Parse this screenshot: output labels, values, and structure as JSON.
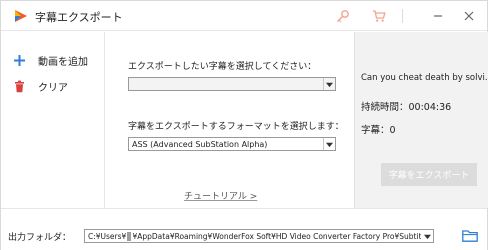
{
  "window": {
    "title": "字幕エクスポート"
  },
  "sidebar": {
    "add_label": "動画を追加",
    "clear_label": "クリア"
  },
  "main": {
    "select_subtitle_label": "エクスポートしたい字幕を選択してください：",
    "subtitle_select_value": "",
    "format_label": "字幕をエクスポートするフォーマットを選択します：",
    "format_select_value": "ASS (Advanced SubStation Alpha)",
    "tutorial_link": "チュートリアル >"
  },
  "info": {
    "file_name": "Can you cheat death by solvi...",
    "duration": "持続時間：00:04:36",
    "subtitle_count": "字幕：0",
    "export_button": "字幕をエクスポート"
  },
  "output": {
    "label": "出力フォルダ：",
    "path_prefix": "C:¥Users¥",
    "path_suffix": "¥AppData¥Roaming¥WonderFox Soft¥HD Video Converter Factory Pro¥Subtitle¥"
  },
  "colors": {
    "add_icon": "#2f7fd6",
    "clear_icon": "#d94040",
    "folder_icon": "#2f7fd6",
    "export_disabled_bg": "#dcdcdc"
  },
  "icons": {
    "logo": "app-logo-icon",
    "key": "key-icon",
    "cart": "cart-icon",
    "minimize": "minimize-icon",
    "close": "close-icon",
    "add": "plus-icon",
    "clear": "trash-icon",
    "folder": "folder-icon"
  }
}
